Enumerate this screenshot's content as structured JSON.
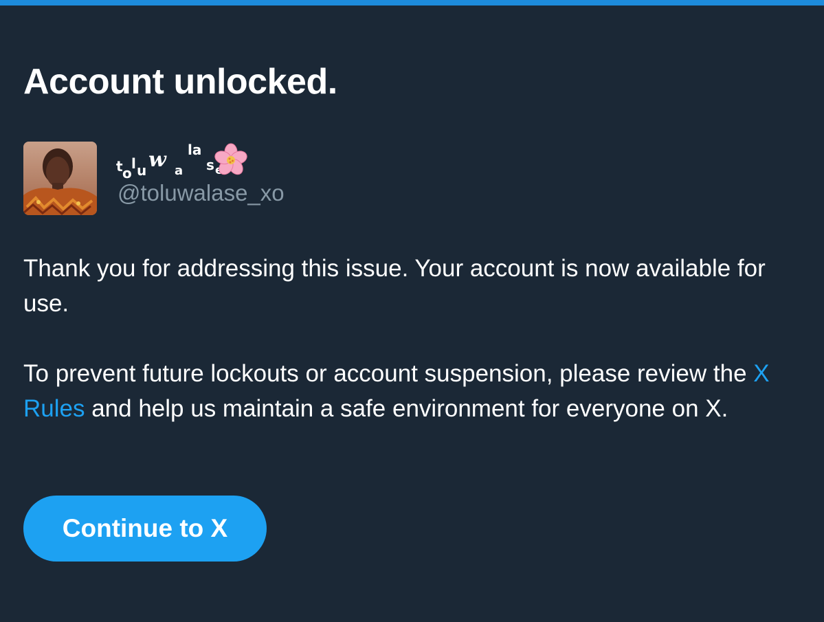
{
  "header": {
    "title": "Account unlocked."
  },
  "user": {
    "display_name_chars": [
      "t",
      "o",
      "l",
      "u",
      "w",
      "a",
      "la",
      "s",
      "e"
    ],
    "display_name_emoji": "cherry-blossom-icon",
    "handle": "@toluwalase_xo",
    "avatar": "avatar-photo"
  },
  "body": {
    "paragraph1": "Thank you for addressing this issue. Your account is now available for use.",
    "paragraph2_before": "To prevent future lockouts or account suspension, please review the ",
    "paragraph2_link": "X Rules",
    "paragraph2_after": " and help us maintain a safe environment for everyone on X."
  },
  "actions": {
    "continue_label": "Continue to X"
  },
  "colors": {
    "background": "#1b2836",
    "top_bar": "#1d8bdb",
    "accent": "#1da1f2",
    "secondary_text": "#8899a6"
  }
}
